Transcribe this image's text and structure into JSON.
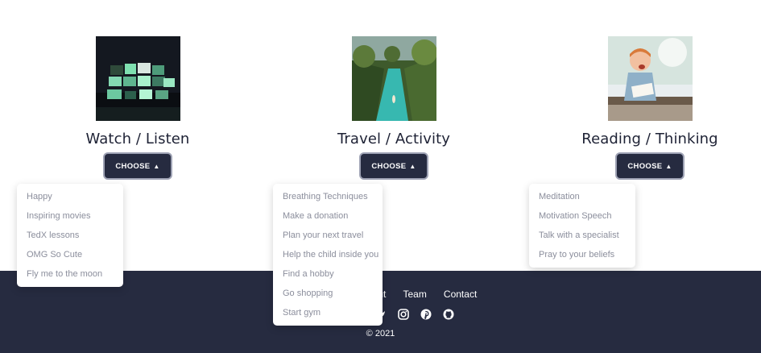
{
  "cards": [
    {
      "title": "Watch / Listen",
      "button": "CHOOSE"
    },
    {
      "title": "Travel / Activity",
      "button": "CHOOSE"
    },
    {
      "title": "Reading / Thinking",
      "button": "CHOOSE"
    }
  ],
  "menus": {
    "watch": [
      "Happy",
      "Inspiring movies",
      "TedX lessons",
      "OMG So Cute",
      "Fly me to the moon"
    ],
    "travel": [
      "Breathing Techniques",
      "Make a donation",
      "Plan your next travel",
      "Help the child inside you",
      "Find a hobby",
      "Go shopping",
      "Start gym"
    ],
    "reading": [
      "Meditation",
      "Motivation Speech",
      "Talk with a specialist",
      "Pray to your beliefs"
    ]
  },
  "footer": {
    "links": [
      "out",
      "Team",
      "Contact"
    ],
    "copyright": "© 2021",
    "icons": [
      "twitter-icon",
      "instagram-icon",
      "pinterest-icon",
      "github-icon"
    ]
  },
  "colors": {
    "dark": "#262b40",
    "menu_text": "#8b8e9c",
    "title": "#1e2235"
  }
}
